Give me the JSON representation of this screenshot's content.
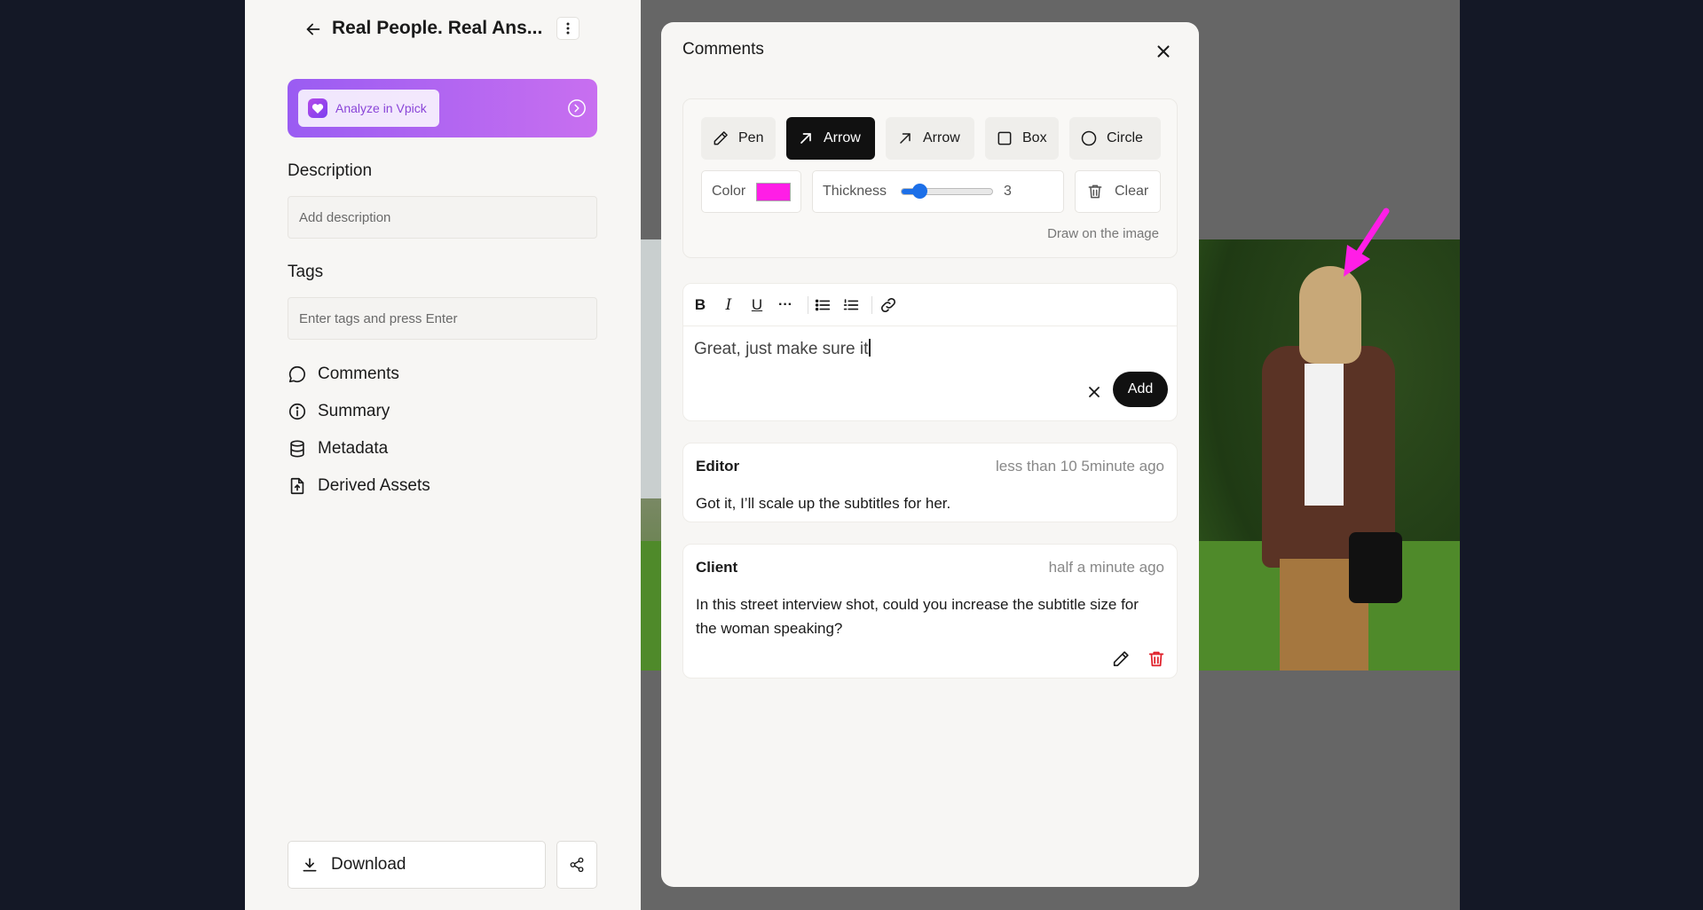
{
  "sidebar": {
    "title": "Real People. Real Ans...",
    "vpick_label": "Analyze in Vpick",
    "description_label": "Description",
    "description_placeholder": "Add description",
    "tags_label": "Tags",
    "tags_placeholder": "Enter tags and press Enter",
    "nav": [
      {
        "label": "Comments",
        "icon": "speech-bubble-icon"
      },
      {
        "label": "Summary",
        "icon": "info-circle-icon"
      },
      {
        "label": "Metadata",
        "icon": "database-icon"
      },
      {
        "label": "Derived Assets",
        "icon": "file-upload-icon"
      }
    ],
    "download_label": "Download"
  },
  "modal": {
    "title": "Comments",
    "tools": [
      {
        "label": "Pen",
        "icon": "pencil-icon",
        "active": false
      },
      {
        "label": "Arrow",
        "icon": "arrow-up-right-icon",
        "active": true
      },
      {
        "label": "Arrow",
        "icon": "arrow-up-right-icon",
        "active": false
      },
      {
        "label": "Box",
        "icon": "square-icon",
        "active": false
      },
      {
        "label": "Circle",
        "icon": "circle-icon",
        "active": false
      }
    ],
    "color_label": "Color",
    "color_value": "#ff1ee6",
    "thickness_label": "Thickness",
    "thickness_value": "3",
    "thickness_fraction": 0.2,
    "clear_label": "Clear",
    "draw_hint": "Draw on the image",
    "editor_text": "Great, just make sure it",
    "add_label": "Add",
    "comments": [
      {
        "author": "Editor",
        "time": "less than 10 5minute ago",
        "body": "Got it, I’ll scale up the subtitles for her."
      },
      {
        "author": "Client",
        "time": "half a minute ago",
        "body": "In this street interview shot, could you increase the subtitle size for the woman speaking?"
      }
    ]
  },
  "colors": {
    "accent": "#111111",
    "annotation": "#ff1ee6",
    "delete": "#e0202a",
    "slider": "#1c6fe8"
  }
}
